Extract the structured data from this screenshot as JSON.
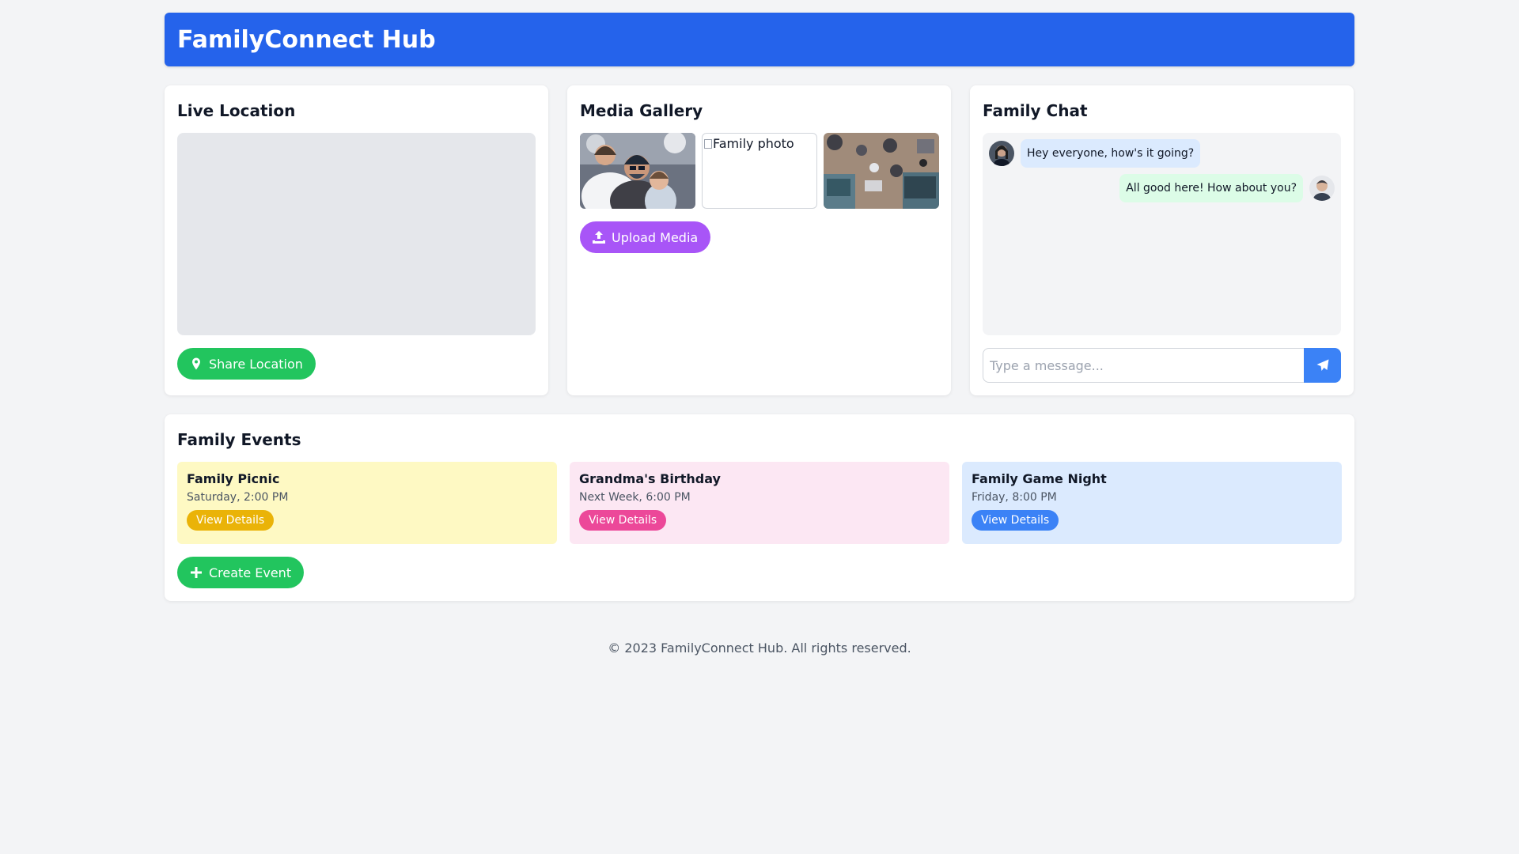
{
  "header": {
    "title": "FamilyConnect Hub",
    "bg": "#2563eb"
  },
  "location": {
    "title": "Live Location",
    "button_label": "Share Location",
    "button_icon": "map-pin-icon"
  },
  "media": {
    "title": "Media Gallery",
    "photos": [
      {
        "alt": ""
      },
      {
        "alt": "Family photo"
      },
      {
        "alt": ""
      }
    ],
    "upload_label": "Upload Media",
    "upload_icon": "upload-icon"
  },
  "chat": {
    "title": "Family Chat",
    "messages": [
      {
        "text": "Hey everyone, how's it going?",
        "side": "left"
      },
      {
        "text": "All good here! How about you?",
        "side": "right"
      }
    ],
    "input_placeholder": "Type a message...",
    "send_icon": "send-icon"
  },
  "events": {
    "title": "Family Events",
    "items": [
      {
        "name": "Family Picnic",
        "when": "Saturday, 2:00 PM",
        "button": "View Details",
        "bg": "#fef9c3",
        "accent": "#eab308"
      },
      {
        "name": "Grandma's Birthday",
        "when": "Next Week, 6:00 PM",
        "button": "View Details",
        "bg": "#fce7f3",
        "accent": "#ec4899"
      },
      {
        "name": "Family Game Night",
        "when": "Friday, 8:00 PM",
        "button": "View Details",
        "bg": "#dbeafe",
        "accent": "#3b82f6"
      }
    ],
    "create_label": "Create Event",
    "create_icon": "plus-icon"
  },
  "footer": {
    "text": "© 2023 FamilyConnect Hub. All rights reserved."
  }
}
